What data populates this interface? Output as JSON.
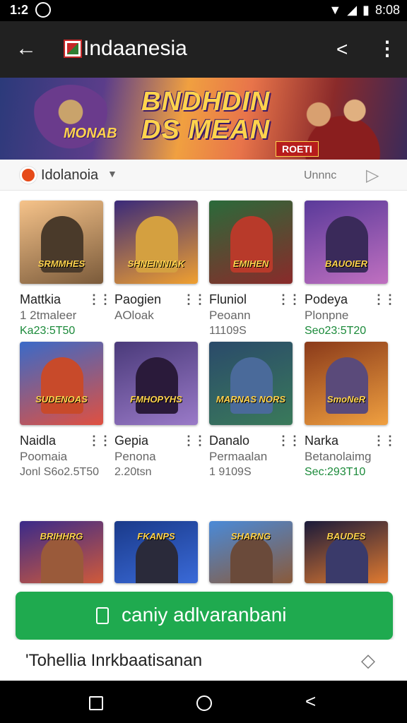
{
  "status_bar": {
    "time": "1:2",
    "clock": "8:08"
  },
  "app_bar": {
    "title": "Indaanesia"
  },
  "banner": {
    "headline_line1": "BNDHDIN",
    "headline_line2": "DS MEAN",
    "subtitle": "MONAB",
    "tag": "ROETI"
  },
  "filter": {
    "region_label": "Idolanoia",
    "sort_label": "Unnnc"
  },
  "games": [
    {
      "name": "Mattkia",
      "developer": "1 2tmaleer",
      "meta": "Ka23:5T50",
      "meta_green": true,
      "caption": "SRMMHES",
      "bg_from": "#f6c38a",
      "bg_to": "#7a5a3a",
      "fig": "#4a3a2a"
    },
    {
      "name": "Paogien",
      "developer": "AOloak",
      "meta": "",
      "meta_green": false,
      "caption": "SHNEINNIAK",
      "bg_from": "#3a2a7a",
      "bg_to": "#f0a030",
      "fig": "#d4a040"
    },
    {
      "name": "Fluniol",
      "developer": "Peoann",
      "meta": "11109S",
      "meta_green": false,
      "caption": "EMIHEN",
      "bg_from": "#2a6a3a",
      "bg_to": "#8a2a2a",
      "fig": "#b83a2a"
    },
    {
      "name": "Podeya",
      "developer": "Plonpne",
      "meta": "Seo23:5T20",
      "meta_green": true,
      "caption": "BAUOIER",
      "bg_from": "#5a3a9a",
      "bg_to": "#c070c0",
      "fig": "#3a2a5a"
    },
    {
      "name": "Naidla",
      "developer": "Poomaia",
      "meta": "Jonl S6o2.5T50",
      "meta_green": false,
      "caption": "SUDENOAS",
      "bg_from": "#3a6ac8",
      "bg_to": "#e05040",
      "fig": "#c84a2a"
    },
    {
      "name": "Gepia",
      "developer": "Penona",
      "meta": "2.20tsn",
      "meta_green": false,
      "caption": "FMHOPYHS",
      "bg_from": "#4a3a7a",
      "bg_to": "#9a7ac8",
      "fig": "#2a1a3a"
    },
    {
      "name": "Danalo",
      "developer": "Permaalan",
      "meta": "1 9109S",
      "meta_green": false,
      "caption": "MARNAS NORS",
      "bg_from": "#2a4a6a",
      "bg_to": "#3a7a5a",
      "fig": "#4a6a9a"
    },
    {
      "name": "Narka",
      "developer": "Betanolaimg",
      "meta": "Sec:293T10",
      "meta_green": true,
      "caption": "SmoNeR",
      "bg_from": "#8a3a1a",
      "bg_to": "#f0a040",
      "fig": "#5a4a7a"
    },
    {
      "name": "",
      "developer": "",
      "meta": "",
      "meta_green": false,
      "caption": "BRIHHRG",
      "bg_from": "#3a2a8a",
      "bg_to": "#d05a3a",
      "fig": "#9a5a3a"
    },
    {
      "name": "",
      "developer": "",
      "meta": "",
      "meta_green": false,
      "caption": "FKANPS",
      "bg_from": "#1a3a8a",
      "bg_to": "#3a6ad8",
      "fig": "#2a2a3a"
    },
    {
      "name": "",
      "developer": "",
      "meta": "",
      "meta_green": false,
      "caption": "SHARNG",
      "bg_from": "#4a8ad8",
      "bg_to": "#8a5a3a",
      "fig": "#6a4a3a"
    },
    {
      "name": "",
      "developer": "",
      "meta": "",
      "meta_green": false,
      "caption": "BAUDES",
      "bg_from": "#1a1a3a",
      "bg_to": "#e07a30",
      "fig": "#3a3a6a"
    }
  ],
  "cta": {
    "label": "caniy adlvaranbani"
  },
  "footer": {
    "text": "'Tohellia Inrkbaatisanan"
  },
  "colors": {
    "accent_green": "#1faa4f",
    "app_bar": "#212121",
    "meta_green": "#1b8a3a"
  }
}
